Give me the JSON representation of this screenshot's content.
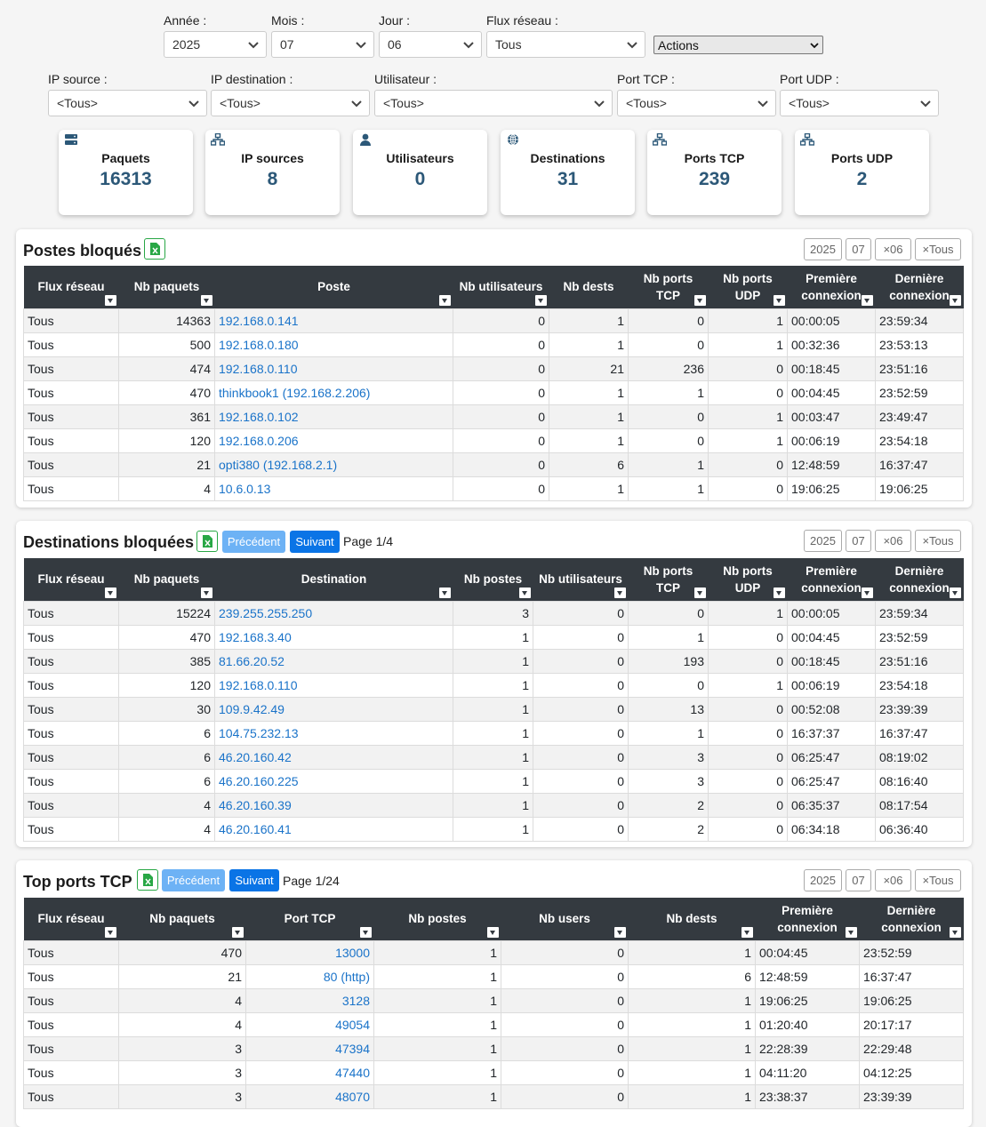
{
  "filters": {
    "annee": {
      "label": "Année :",
      "value": "2025"
    },
    "mois": {
      "label": "Mois :",
      "value": "07"
    },
    "jour": {
      "label": "Jour :",
      "value": "06"
    },
    "flux": {
      "label": "Flux réseau :",
      "value": "Tous"
    },
    "actions": {
      "value": "Actions"
    },
    "ip_source": {
      "label": "IP source :",
      "value": "<Tous>"
    },
    "ip_dest": {
      "label": "IP destination :",
      "value": "<Tous>"
    },
    "utilisateur": {
      "label": "Utilisateur :",
      "value": "<Tous>"
    },
    "port_tcp": {
      "label": "Port TCP :",
      "value": "<Tous>"
    },
    "port_udp": {
      "label": "Port UDP :",
      "value": "<Tous>"
    }
  },
  "kpis": [
    {
      "label": "Paquets",
      "value": "16313",
      "icon": "server-icon"
    },
    {
      "label": "IP sources",
      "value": "8",
      "icon": "network-icon"
    },
    {
      "label": "Utilisateurs",
      "value": "0",
      "icon": "user-icon"
    },
    {
      "label": "Destinations",
      "value": "31",
      "icon": "globe-icon"
    },
    {
      "label": "Ports TCP",
      "value": "239",
      "icon": "network-icon"
    },
    {
      "label": "Ports UDP",
      "value": "2",
      "icon": "network-icon"
    }
  ],
  "filter_buttons": {
    "year": "2025",
    "month": "07",
    "day": "×06",
    "all": "×Tous"
  },
  "postes": {
    "title": "Postes bloqués",
    "headers": [
      "Flux réseau",
      "Nb paquets",
      "Poste",
      "Nb utilisateurs",
      "Nb dests",
      "Nb ports TCP",
      "Nb ports UDP",
      "Première connexion",
      "Dernière connexion"
    ],
    "rows": [
      [
        "Tous",
        "14363",
        "192.168.0.141",
        "0",
        "1",
        "0",
        "1",
        "00:00:05",
        "23:59:34"
      ],
      [
        "Tous",
        "500",
        "192.168.0.180",
        "0",
        "1",
        "0",
        "1",
        "00:32:36",
        "23:53:13"
      ],
      [
        "Tous",
        "474",
        "192.168.0.110",
        "0",
        "21",
        "236",
        "0",
        "00:18:45",
        "23:51:16"
      ],
      [
        "Tous",
        "470",
        "thinkbook1 (192.168.2.206)",
        "0",
        "1",
        "1",
        "0",
        "00:04:45",
        "23:52:59"
      ],
      [
        "Tous",
        "361",
        "192.168.0.102",
        "0",
        "1",
        "0",
        "1",
        "00:03:47",
        "23:49:47"
      ],
      [
        "Tous",
        "120",
        "192.168.0.206",
        "0",
        "1",
        "0",
        "1",
        "00:06:19",
        "23:54:18"
      ],
      [
        "Tous",
        "21",
        "opti380 (192.168.2.1)",
        "0",
        "6",
        "1",
        "0",
        "12:48:59",
        "16:37:47"
      ],
      [
        "Tous",
        "4",
        "10.6.0.13",
        "0",
        "1",
        "1",
        "0",
        "19:06:25",
        "19:06:25"
      ]
    ]
  },
  "destinations": {
    "title": "Destinations bloquées",
    "prev": "Précédent",
    "next": "Suivant",
    "page": "Page 1/4",
    "headers": [
      "Flux réseau",
      "Nb paquets",
      "Destination",
      "Nb postes",
      "Nb utilisateurs",
      "Nb ports TCP",
      "Nb ports UDP",
      "Première connexion",
      "Dernière connexion"
    ],
    "rows": [
      [
        "Tous",
        "15224",
        "239.255.255.250",
        "3",
        "0",
        "0",
        "1",
        "00:00:05",
        "23:59:34"
      ],
      [
        "Tous",
        "470",
        "192.168.3.40",
        "1",
        "0",
        "1",
        "0",
        "00:04:45",
        "23:52:59"
      ],
      [
        "Tous",
        "385",
        "81.66.20.52",
        "1",
        "0",
        "193",
        "0",
        "00:18:45",
        "23:51:16"
      ],
      [
        "Tous",
        "120",
        "192.168.0.110",
        "1",
        "0",
        "0",
        "1",
        "00:06:19",
        "23:54:18"
      ],
      [
        "Tous",
        "30",
        "109.9.42.49",
        "1",
        "0",
        "13",
        "0",
        "00:52:08",
        "23:39:39"
      ],
      [
        "Tous",
        "6",
        "104.75.232.13",
        "1",
        "0",
        "1",
        "0",
        "16:37:37",
        "16:37:47"
      ],
      [
        "Tous",
        "6",
        "46.20.160.42",
        "1",
        "0",
        "3",
        "0",
        "06:25:47",
        "08:19:02"
      ],
      [
        "Tous",
        "6",
        "46.20.160.225",
        "1",
        "0",
        "3",
        "0",
        "06:25:47",
        "08:16:40"
      ],
      [
        "Tous",
        "4",
        "46.20.160.39",
        "1",
        "0",
        "2",
        "0",
        "06:35:37",
        "08:17:54"
      ],
      [
        "Tous",
        "4",
        "46.20.160.41",
        "1",
        "0",
        "2",
        "0",
        "06:34:18",
        "06:36:40"
      ]
    ]
  },
  "ports": {
    "title": "Top ports TCP",
    "prev": "Précédent",
    "next": "Suivant",
    "page": "Page 1/24",
    "headers": [
      "Flux réseau",
      "Nb paquets",
      "Port TCP",
      "Nb postes",
      "Nb users",
      "Nb dests",
      "Première connexion",
      "Dernière connexion"
    ],
    "rows": [
      [
        "Tous",
        "470",
        "13000",
        "1",
        "0",
        "1",
        "00:04:45",
        "23:52:59"
      ],
      [
        "Tous",
        "21",
        "80 (http)",
        "1",
        "0",
        "6",
        "12:48:59",
        "16:37:47"
      ],
      [
        "Tous",
        "4",
        "3128",
        "1",
        "0",
        "1",
        "19:06:25",
        "19:06:25"
      ],
      [
        "Tous",
        "4",
        "49054",
        "1",
        "0",
        "1",
        "01:20:40",
        "20:17:17"
      ],
      [
        "Tous",
        "3",
        "47394",
        "1",
        "0",
        "1",
        "22:28:39",
        "22:29:48"
      ],
      [
        "Tous",
        "3",
        "47440",
        "1",
        "0",
        "1",
        "04:11:20",
        "04:12:25"
      ],
      [
        "Tous",
        "3",
        "48070",
        "1",
        "0",
        "1",
        "23:38:37",
        "23:39:39"
      ]
    ]
  }
}
